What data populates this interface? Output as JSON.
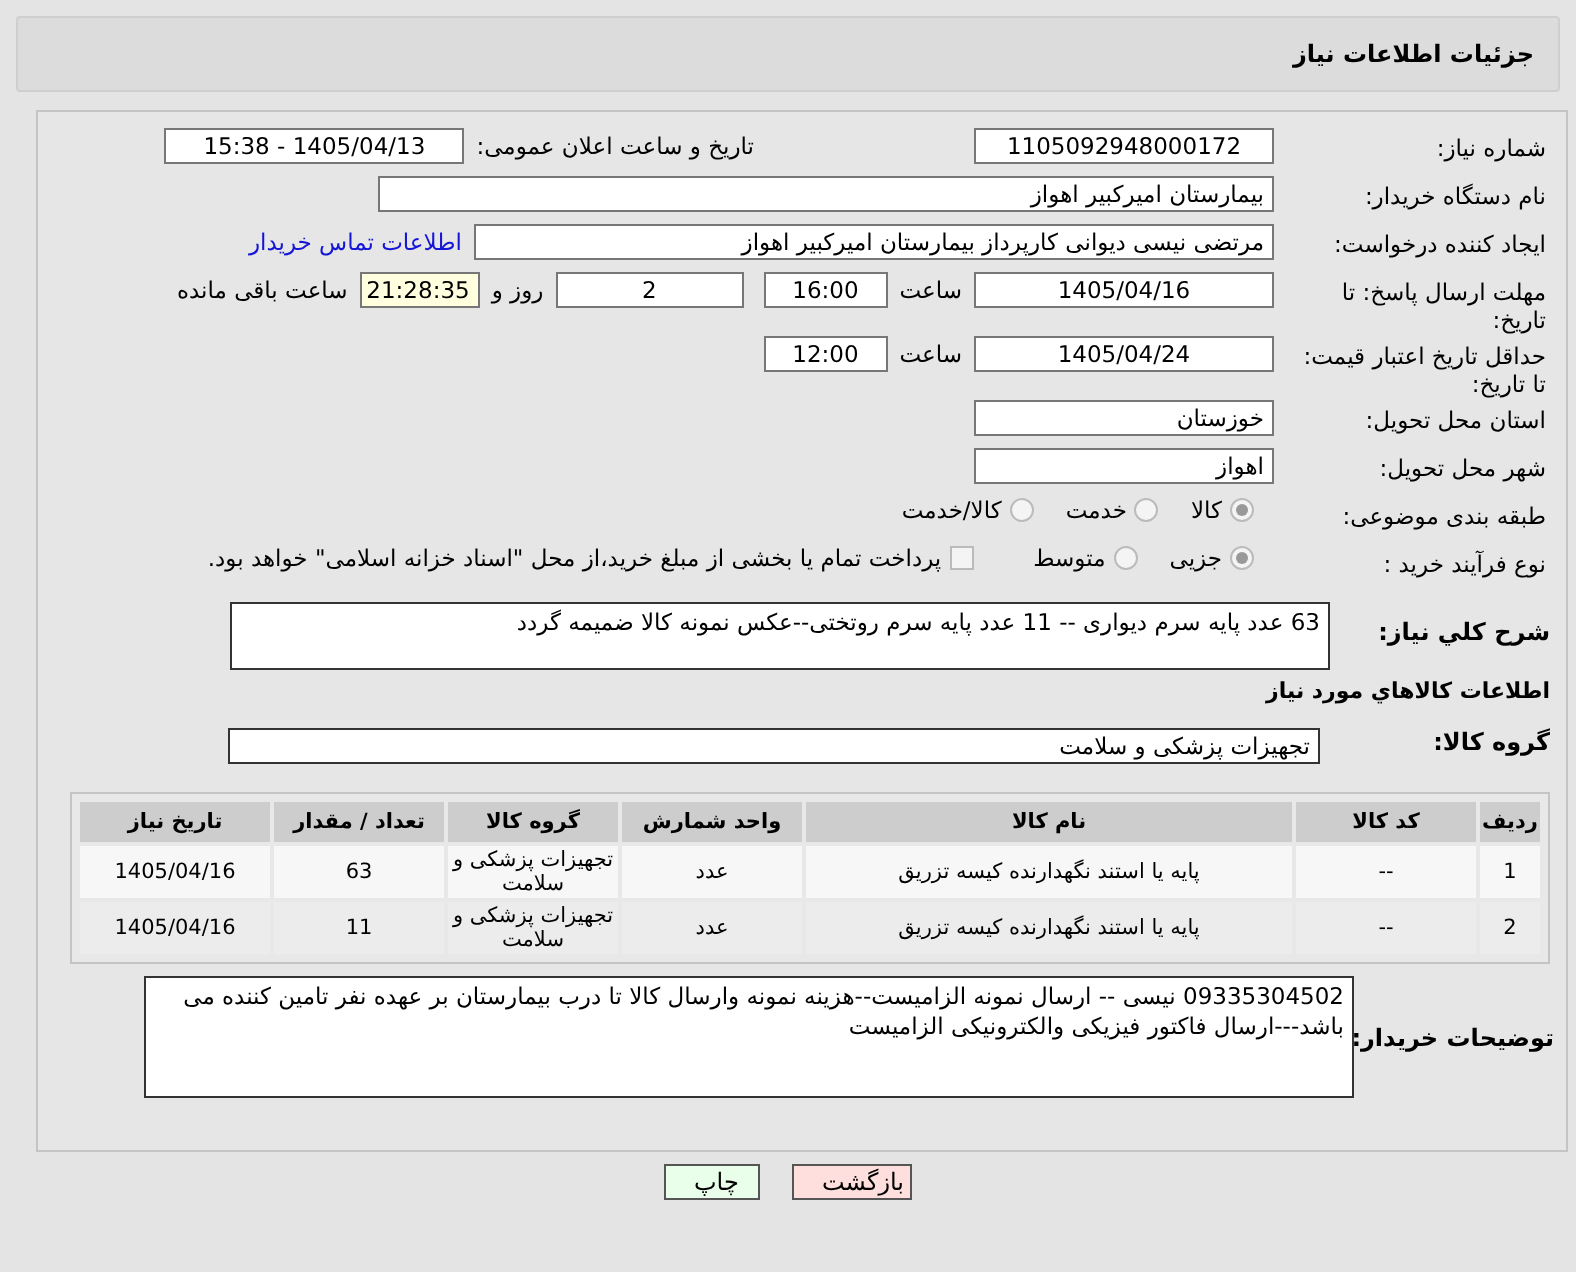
{
  "header": {
    "title": "جزئیات اطلاعات نیاز"
  },
  "rows": [
    {
      "kind": "first",
      "label": "شماره نیاز:",
      "cells": [
        {
          "kind": "date",
          "value": "1105092948000172"
        },
        {
          "kind": "text",
          "value": "تاریخ و ساعت اعلان عمومی:"
        },
        {
          "kind": "date",
          "value": "1405/04/13 - 15:38"
        }
      ]
    },
    {
      "kind": "plain",
      "label": "نام دستگاه خریدار:",
      "cells": [
        {
          "kind": "long",
          "value": "بیمارستان امیرکبیر اهواز"
        }
      ]
    },
    {
      "kind": "plain",
      "label": "ایجاد کننده درخواست:",
      "cells": [
        {
          "kind": "creator",
          "value": "مرتضی نیسی دیوانی کارپرداز بیمارستان امیرکبیر اهواز"
        },
        {
          "kind": "link",
          "value": "اطلاعات تماس خریدار"
        }
      ]
    },
    {
      "kind": "tall",
      "label": "مهلت ارسال پاسخ: تا تاریخ:",
      "cells": [
        {
          "kind": "date",
          "value": "1405/04/16"
        },
        {
          "kind": "text",
          "value": "ساعت"
        },
        {
          "kind": "time",
          "value": "16:00"
        },
        {
          "kind": "days",
          "value": "2"
        },
        {
          "kind": "text",
          "value": "روز و"
        },
        {
          "kind": "remain",
          "value": "21:28:35"
        },
        {
          "kind": "text",
          "value": "ساعت باقی مانده"
        }
      ]
    },
    {
      "kind": "tall",
      "label": "حداقل تاریخ اعتبار قیمت: تا تاریخ:",
      "cells": [
        {
          "kind": "date",
          "value": "1405/04/24"
        },
        {
          "kind": "text",
          "value": "ساعت"
        },
        {
          "kind": "time",
          "value": "12:00"
        }
      ]
    },
    {
      "kind": "plain",
      "label": "استان محل تحویل:",
      "cells": [
        {
          "kind": "place",
          "value": "خوزستان"
        }
      ]
    },
    {
      "kind": "plain",
      "label": "شهر محل تحویل:",
      "cells": [
        {
          "kind": "place",
          "value": "اهواز"
        }
      ]
    },
    {
      "kind": "plain",
      "label": "طبقه بندی موضوعی:",
      "cells": [
        {
          "kind": "radio",
          "value": "کالا",
          "selected": true
        },
        {
          "kind": "radio",
          "value": "خدمت",
          "selected": false
        },
        {
          "kind": "radio",
          "value": "کالا/خدمت",
          "selected": false
        }
      ]
    },
    {
      "kind": "plain",
      "label": "نوع فرآیند خرید :",
      "cells": [
        {
          "kind": "radio",
          "value": "جزیی",
          "selected": true
        },
        {
          "kind": "radio",
          "value": "متوسط",
          "selected": false
        },
        {
          "kind": "checkbox",
          "value": "پرداخت تمام یا بخشی از مبلغ خرید،از محل \"اسناد خزانه اسلامی\" خواهد بود.",
          "checked": false
        }
      ]
    }
  ],
  "description": {
    "label": "شرح کلي نياز:",
    "value": "63 عدد پایه سرم دیواری -- 11 عدد پایه سرم روتختی--عکس نمونه کالا ضمیمه گردد"
  },
  "items_title": "اطلاعات کالاهاي مورد نياز",
  "group": {
    "label": "گروه کالا:",
    "value": "تجهیزات پزشکی و سلامت"
  },
  "table": {
    "columns": [
      "ردیف",
      "کد کالا",
      "نام کالا",
      "واحد شمارش",
      "گروه کالا",
      "تعداد / مقدار",
      "تاریخ نیاز"
    ],
    "rows": [
      [
        "1",
        "--",
        "پایه یا استند نگهدارنده کیسه تزریق",
        "عدد",
        "تجهیزات پزشکی و سلامت",
        "63",
        "1405/04/16"
      ],
      [
        "2",
        "--",
        "پایه یا استند نگهدارنده کیسه تزریق",
        "عدد",
        "تجهیزات پزشکی و سلامت",
        "11",
        "1405/04/16"
      ]
    ]
  },
  "notes": {
    "label": "توضیحات خریدار:",
    "value": "09335304502 نیسی -- ارسال نمونه الزامیست--هزینه نمونه وارسال کالا تا درب بیمارستان بر عهده نفر تامین کننده می باشد---ارسال فاکتور فیزیکی والکترونیکی الزامیست"
  },
  "buttons": [
    {
      "kind": "back",
      "label": "بازگشت"
    },
    {
      "kind": "print",
      "label": "چاپ"
    }
  ]
}
